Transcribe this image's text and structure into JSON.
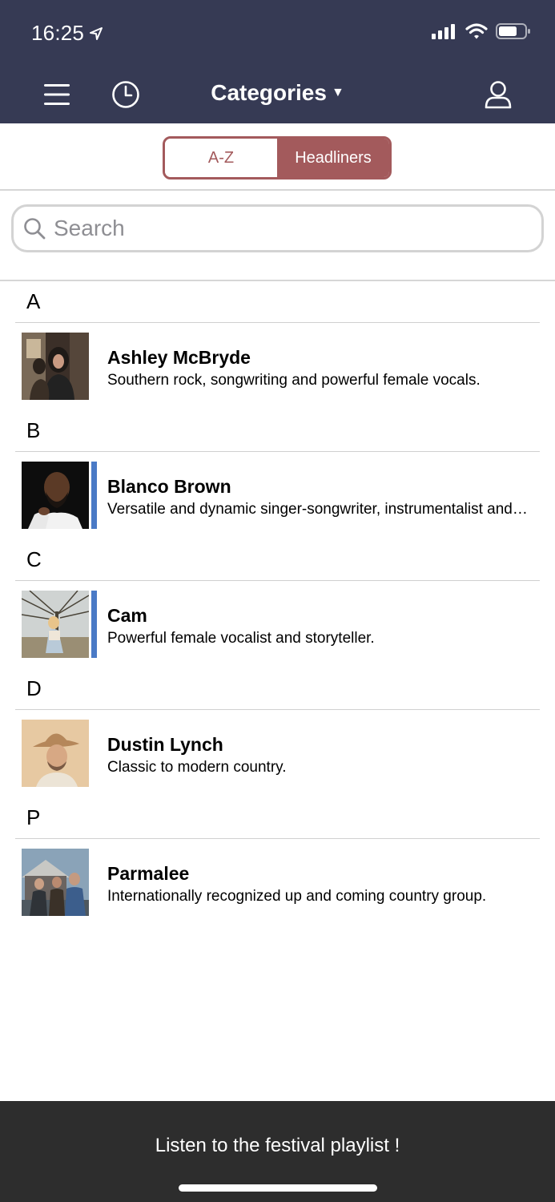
{
  "status_bar": {
    "time": "16:25"
  },
  "nav": {
    "title": "Categories"
  },
  "segments": {
    "az_label": "A-Z",
    "headliners_label": "Headliners"
  },
  "search": {
    "placeholder": "Search"
  },
  "sections": [
    {
      "letter": "A",
      "artists": [
        {
          "name": "Ashley McBryde",
          "desc": "Southern rock, songwriting and powerful female vocals.",
          "highlighted": false
        }
      ]
    },
    {
      "letter": "B",
      "artists": [
        {
          "name": "Blanco Brown",
          "desc": "Versatile and dynamic singer-songwriter, instrumentalist and producer.",
          "highlighted": true
        }
      ]
    },
    {
      "letter": "C",
      "artists": [
        {
          "name": "Cam",
          "desc": "Powerful female vocalist and storyteller.",
          "highlighted": true
        }
      ]
    },
    {
      "letter": "D",
      "artists": [
        {
          "name": "Dustin Lynch",
          "desc": "Classic to modern country.",
          "highlighted": false
        }
      ]
    },
    {
      "letter": "P",
      "artists": [
        {
          "name": "Parmalee",
          "desc": "Internationally recognized up and coming country group.",
          "highlighted": false
        }
      ]
    }
  ],
  "footer": {
    "playlist_label": "Listen to the festival playlist !"
  },
  "colors": {
    "header_bg": "#363a54",
    "accent": "#a35a5c",
    "highlight_bar": "#4a7ac6",
    "footer_bg": "#2d2d2d"
  }
}
